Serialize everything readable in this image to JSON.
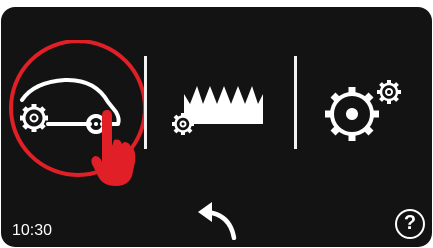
{
  "status": {
    "time": "10:30"
  },
  "help": {
    "label": "?"
  },
  "menu": {
    "items": [
      {
        "icon": "car-gear-icon",
        "selected": true
      },
      {
        "icon": "grass-gear-icon",
        "selected": false
      },
      {
        "icon": "settings-gears-icon",
        "selected": false
      }
    ]
  },
  "navigation": {
    "back_icon": "back-arrow-icon"
  },
  "colors": {
    "panel": "#131313",
    "foreground": "#ffffff",
    "selection_ring": "#e01f26",
    "pointer_hand": "#e01f26"
  }
}
